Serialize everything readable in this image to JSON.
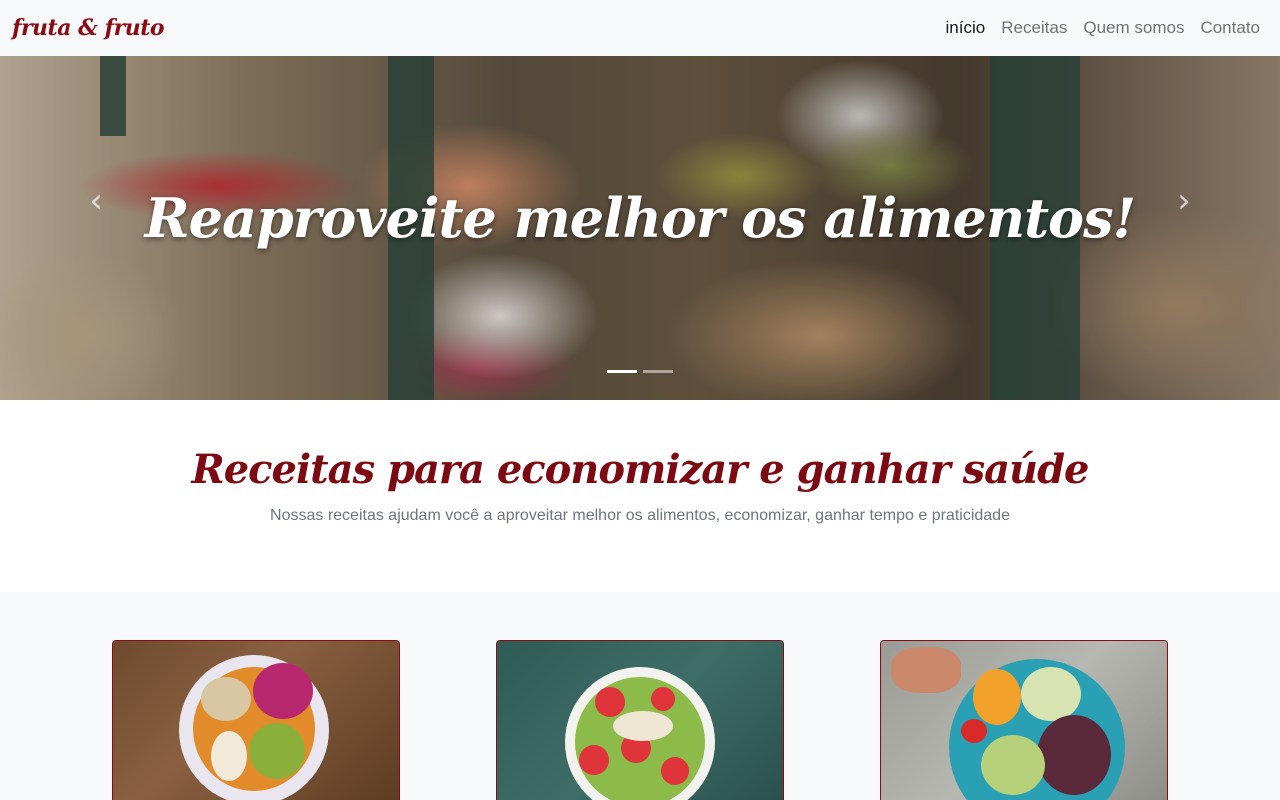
{
  "navbar": {
    "brand": "fruta & fruto",
    "links": [
      {
        "label": "início",
        "active": true
      },
      {
        "label": "Receitas",
        "active": false
      },
      {
        "label": "Quem somos",
        "active": false
      },
      {
        "label": "Contato",
        "active": false
      }
    ]
  },
  "hero": {
    "caption": "Reaproveite melhor os alimentos!",
    "prev_icon": "chevron-left-icon",
    "next_icon": "chevron-right-icon",
    "slides_count": 2,
    "active_slide": 1
  },
  "intro": {
    "title": "Receitas para economizar e ganhar saúde",
    "subtitle": "Nossas receitas ajudam você a aproveitar melhor os alimentos, economizar, ganhar tempo e praticidade"
  },
  "colors": {
    "brand": "#8b0a14",
    "navbar_bg": "#f8f9fa",
    "muted_text": "#6c757d",
    "section_bg": "#f8f9fa"
  },
  "cards": [
    {
      "image": "acai-bowl-image"
    },
    {
      "image": "kiwi-bowl-image"
    },
    {
      "image": "salad-bowl-image"
    }
  ]
}
